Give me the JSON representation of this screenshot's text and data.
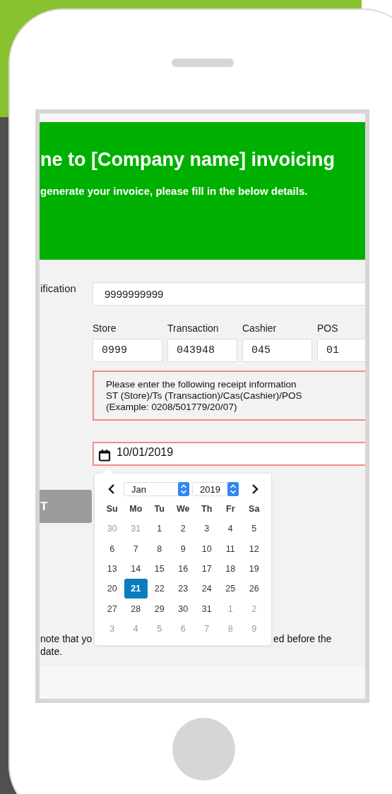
{
  "header": {
    "title": "ne to [Company name] invoicing",
    "subtitle": "generate your invoice, please fill in the below details."
  },
  "identification": {
    "label": "ification",
    "value": "9999999999"
  },
  "receipt_fields": [
    {
      "label": "Store",
      "value": "0999"
    },
    {
      "label": "Transaction",
      "value": "043948"
    },
    {
      "label": "Cashier",
      "value": "045"
    },
    {
      "label": "POS",
      "value": "01"
    }
  ],
  "info_box": {
    "text": "Please enter the following receipt information\nST (Store)/Ts (Transaction)/Cas(Cashier)/POS\n(Example: 0208/501779/20/07)"
  },
  "date_field": {
    "value": "10/01/2019"
  },
  "button": {
    "label": "T"
  },
  "note": {
    "line_1_start": "note that yo",
    "line_1_end": "ed before the",
    "line_2": "date."
  },
  "datepicker": {
    "month": "Jan",
    "year": "2019",
    "weekdays": [
      "Su",
      "Mo",
      "Tu",
      "We",
      "Th",
      "Fr",
      "Sa"
    ],
    "weeks": [
      [
        {
          "day": "30",
          "other_month": true,
          "selected": false
        },
        {
          "day": "31",
          "other_month": true,
          "selected": false
        },
        {
          "day": "1",
          "other_month": false,
          "selected": false
        },
        {
          "day": "2",
          "other_month": false,
          "selected": false
        },
        {
          "day": "3",
          "other_month": false,
          "selected": false
        },
        {
          "day": "4",
          "other_month": false,
          "selected": false
        },
        {
          "day": "5",
          "other_month": false,
          "selected": false
        }
      ],
      [
        {
          "day": "6",
          "other_month": false,
          "selected": false
        },
        {
          "day": "7",
          "other_month": false,
          "selected": false
        },
        {
          "day": "8",
          "other_month": false,
          "selected": false
        },
        {
          "day": "9",
          "other_month": false,
          "selected": false
        },
        {
          "day": "10",
          "other_month": false,
          "selected": false
        },
        {
          "day": "11",
          "other_month": false,
          "selected": false
        },
        {
          "day": "12",
          "other_month": false,
          "selected": false
        }
      ],
      [
        {
          "day": "13",
          "other_month": false,
          "selected": false
        },
        {
          "day": "14",
          "other_month": false,
          "selected": false
        },
        {
          "day": "15",
          "other_month": false,
          "selected": false
        },
        {
          "day": "16",
          "other_month": false,
          "selected": false
        },
        {
          "day": "17",
          "other_month": false,
          "selected": false
        },
        {
          "day": "18",
          "other_month": false,
          "selected": false
        },
        {
          "day": "19",
          "other_month": false,
          "selected": false
        }
      ],
      [
        {
          "day": "20",
          "other_month": false,
          "selected": false
        },
        {
          "day": "21",
          "other_month": false,
          "selected": true
        },
        {
          "day": "22",
          "other_month": false,
          "selected": false
        },
        {
          "day": "23",
          "other_month": false,
          "selected": false
        },
        {
          "day": "24",
          "other_month": false,
          "selected": false
        },
        {
          "day": "25",
          "other_month": false,
          "selected": false
        },
        {
          "day": "26",
          "other_month": false,
          "selected": false
        }
      ],
      [
        {
          "day": "27",
          "other_month": false,
          "selected": false
        },
        {
          "day": "28",
          "other_month": false,
          "selected": false
        },
        {
          "day": "29",
          "other_month": false,
          "selected": false
        },
        {
          "day": "30",
          "other_month": false,
          "selected": false
        },
        {
          "day": "31",
          "other_month": false,
          "selected": false
        },
        {
          "day": "1",
          "other_month": true,
          "selected": false
        },
        {
          "day": "2",
          "other_month": true,
          "selected": false
        }
      ],
      [
        {
          "day": "3",
          "other_month": true,
          "selected": false
        },
        {
          "day": "4",
          "other_month": true,
          "selected": false
        },
        {
          "day": "5",
          "other_month": true,
          "selected": false
        },
        {
          "day": "6",
          "other_month": true,
          "selected": false
        },
        {
          "day": "7",
          "other_month": true,
          "selected": false
        },
        {
          "day": "8",
          "other_month": true,
          "selected": false
        },
        {
          "day": "9",
          "other_month": true,
          "selected": false
        }
      ]
    ]
  }
}
